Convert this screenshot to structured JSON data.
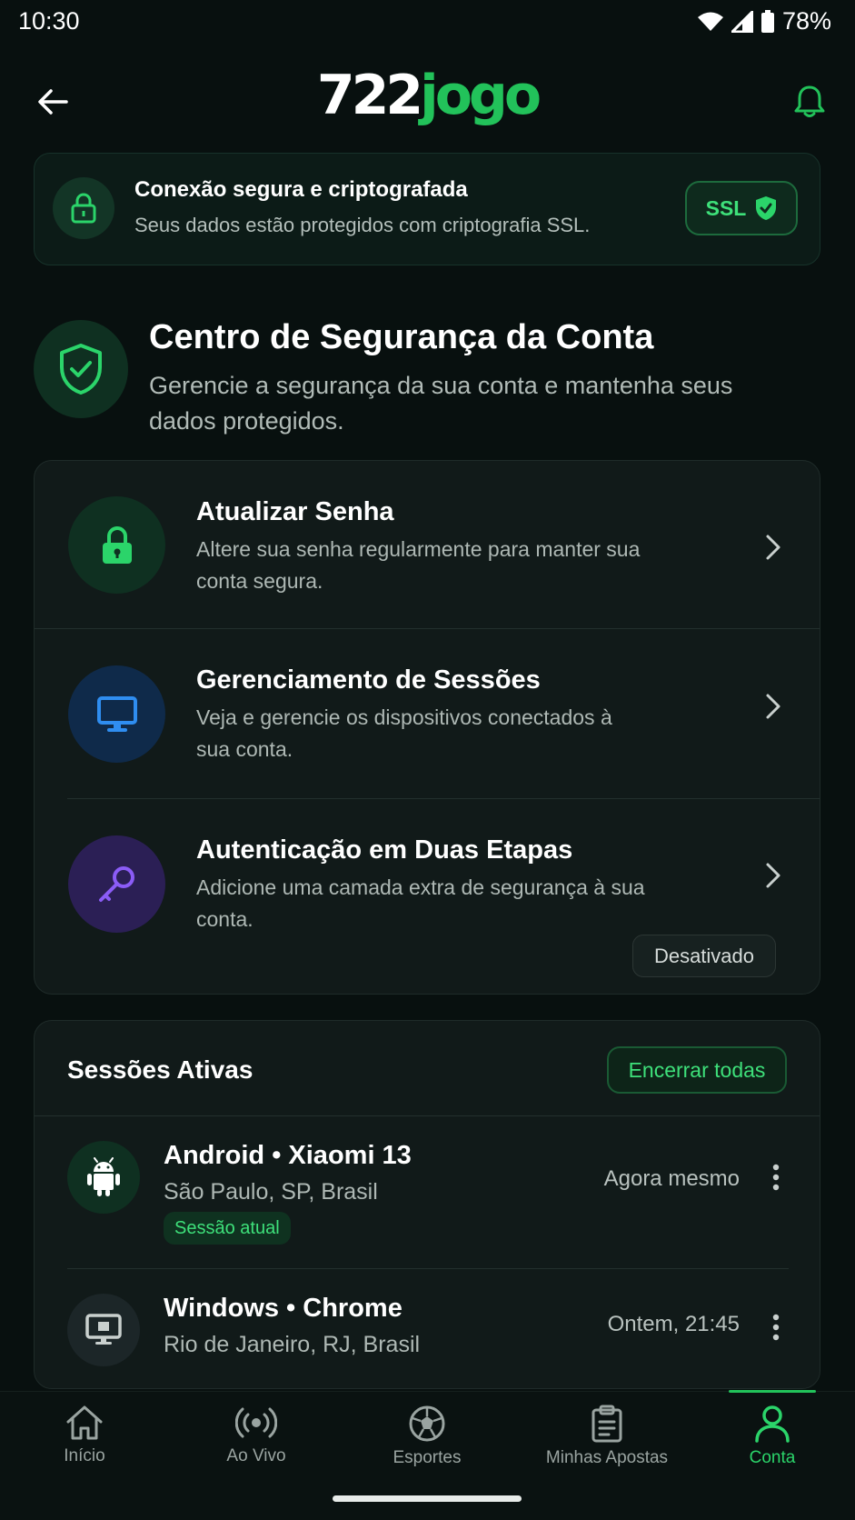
{
  "status_bar": {
    "time": "10:30",
    "battery": "78%"
  },
  "header": {
    "logo_number": "722",
    "logo_word": "jogo"
  },
  "ssl_banner": {
    "title": "Conexão segura e criptografada",
    "subtitle": "Seus dados estão protegidos com criptografia SSL.",
    "badge": "SSL"
  },
  "security_center": {
    "title": "Centro de Segurança da Conta",
    "subtitle": "Gerencie a segurança da sua conta e mantenha seus dados protegidos."
  },
  "options": [
    {
      "title": "Atualizar Senha",
      "description": "Altere sua senha regularmente para manter sua conta segura.",
      "icon": "lock-icon",
      "color": "#2bd46a"
    },
    {
      "title": "Gerenciamento de Sessões",
      "description": "Veja e gerencie os dispositivos conectados à sua conta.",
      "icon": "monitor-icon",
      "color": "#2f8df0"
    },
    {
      "title": "Autenticação em Duas Etapas",
      "description": "Adicione uma camada extra de segurança à sua conta.",
      "icon": "wrench-icon",
      "color": "#8b5cf6",
      "status": "Desativado"
    }
  ],
  "sessions": {
    "title": "Sessões Ativas",
    "end_all_label": "Encerrar todas",
    "items": [
      {
        "device": "Android • Xiaomi 13",
        "location": "São Paulo, SP, Brasil",
        "time": "Agora mesmo",
        "badge": "Sessão atual",
        "icon": "android-icon"
      },
      {
        "device": "Windows • Chrome",
        "location": "Rio de Janeiro, RJ, Brasil",
        "time": "Ontem, 21:45",
        "icon": "desktop-icon"
      }
    ]
  },
  "bottom_nav": [
    {
      "label": "Início",
      "icon": "home-icon"
    },
    {
      "label": "Ao Vivo",
      "icon": "live-icon"
    },
    {
      "label": "Esportes",
      "icon": "soccer-ball-icon"
    },
    {
      "label": "Minhas Apostas",
      "icon": "clipboard-icon"
    },
    {
      "label": "Conta",
      "icon": "user-icon",
      "active": true
    }
  ],
  "colors": {
    "accent": "#22c25a",
    "background": "#08100f",
    "card": "#111a19"
  }
}
